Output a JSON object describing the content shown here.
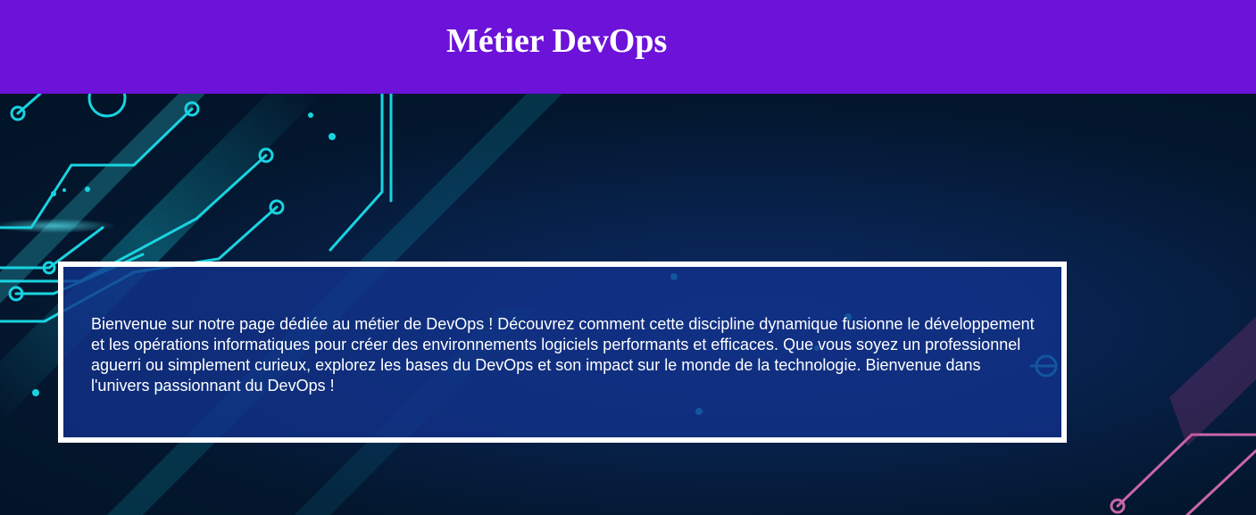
{
  "header": {
    "title": "Métier DevOps",
    "background_color": "#6c12d9"
  },
  "hero": {
    "background": "circuit-board-illustration",
    "accent_colors": [
      "#19d3e0",
      "#e06fb5",
      "#03172f"
    ]
  },
  "intro": {
    "text": "Bienvenue sur notre page dédiée au métier de DevOps ! Découvrez comment cette discipline dynamique fusionne le développement et les opérations informatiques pour créer des environnements logiciels performants et efficaces. Que vous soyez un professionnel aguerri ou simplement curieux, explorez les bases du DevOps et son impact sur le monde de la technologie. Bienvenue dans l'univers passionnant du DevOps !",
    "border_color": "#ffffff"
  }
}
